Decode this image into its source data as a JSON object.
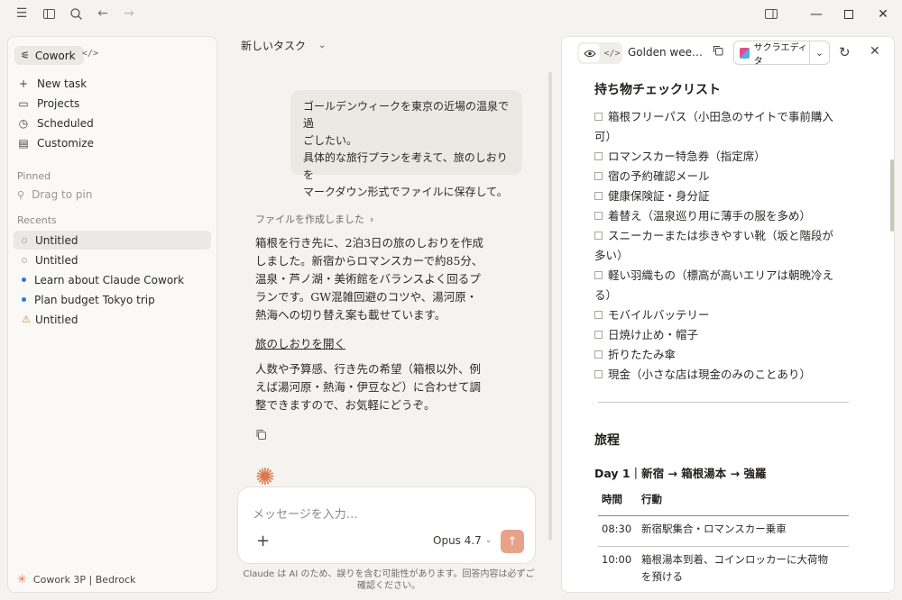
{
  "app": {
    "window_controls": [
      "minimize",
      "maximize",
      "close"
    ]
  },
  "sidebar": {
    "mode_label": "Cowork",
    "nav": [
      {
        "label": "New task",
        "icon": "plus-icon"
      },
      {
        "label": "Projects",
        "icon": "folder-icon"
      },
      {
        "label": "Scheduled",
        "icon": "clock-icon"
      },
      {
        "label": "Customize",
        "icon": "briefcase-icon"
      }
    ],
    "pinned_label": "Pinned",
    "drag_to_pin": "Drag to pin",
    "recents_label": "Recents",
    "recents": [
      {
        "label": "Untitled",
        "status": "hollow"
      },
      {
        "label": "Untitled",
        "status": "hollow"
      },
      {
        "label": "Learn about Claude Cowork",
        "status": "blue"
      },
      {
        "label": "Plan budget Tokyo trip",
        "status": "blue"
      },
      {
        "label": "Untitled",
        "status": "warning"
      }
    ],
    "footer": "Cowork 3P | Bedrock"
  },
  "chat": {
    "title": "新しいタスク",
    "user_message": [
      "ゴールデンウィークを東京の近場の温泉で過",
      "ごしたい。",
      "具体的な旅行プランを考えて、旅のしおりを",
      "マークダウン形式でファイルに保存して。"
    ],
    "file_created": "ファイルを作成しました",
    "reply_1": [
      "箱根を行き先に、2泊3日の旅のしおりを作成",
      "しました。新宿からロマンスカーで約85分、",
      "温泉・芦ノ湖・美術館をバランスよく回るプ",
      "ランです。GW混雑回避のコツや、湯河原・",
      "熱海への切り替え案も載せています。"
    ],
    "open_link": "旅のしおりを開く",
    "reply_2": [
      "人数や予算感、行き先の希望（箱根以外、例",
      "えば湯河原・熱海・伊豆など）に合わせて調",
      "整できますので、お気軽にどうぞ。"
    ],
    "composer_placeholder": "メッセージを入力…",
    "model": "Opus 4.7",
    "disclaimer": "Claude は AI のため、誤りを含む可能性があります。回答内容は必ずご確認ください。"
  },
  "panel": {
    "doc_title": "Golden wee…",
    "open_in_app": "サクラエディタ",
    "checklist_heading": "持ち物チェックリスト",
    "checklist": [
      [
        "箱根フリーパス（小田急のサイトで事前購入",
        "可）"
      ],
      [
        "ロマンスカー特急券（指定席）"
      ],
      [
        "宿の予約確認メール"
      ],
      [
        "健康保険証・身分証"
      ],
      [
        "着替え（温泉巡り用に薄手の服を多め）"
      ],
      [
        "スニーカーまたは歩きやすい靴（坂と階段が",
        "多い）"
      ],
      [
        "軽い羽織もの（標高が高いエリアは朝晩冷え",
        "る）"
      ],
      [
        "モバイルバッテリー"
      ],
      [
        "日焼け止め・帽子"
      ],
      [
        "折りたたみ傘"
      ],
      [
        "現金（小さな店は現金のみのことあり）"
      ]
    ],
    "itinerary_heading": "旅程",
    "day1_heading": "Day 1｜新宿 → 箱根湯本 → 強羅",
    "table_headers": [
      "時間",
      "行動"
    ],
    "table_rows": [
      {
        "time": "08:30",
        "action": [
          "新宿駅集合・ロマンスカー乗車"
        ]
      },
      {
        "time": "10:00",
        "action": [
          "箱根湯本到着、コインロッカーに大荷物",
          "を預ける"
        ]
      }
    ]
  }
}
